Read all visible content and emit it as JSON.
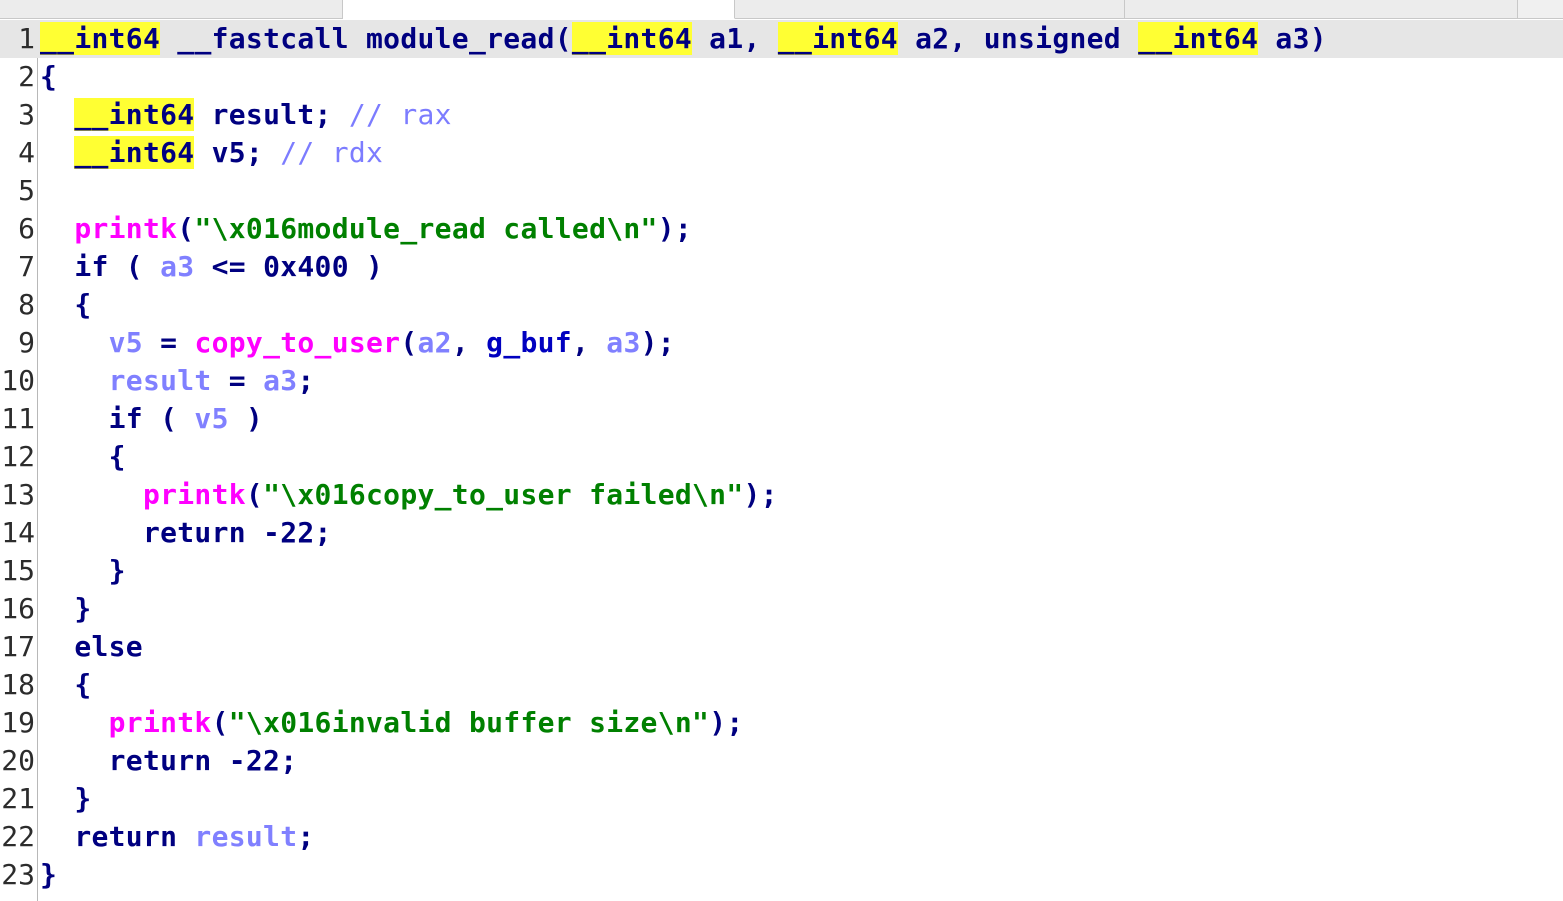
{
  "window": {
    "tabs": [
      {
        "label": ""
      },
      {
        "label": ""
      },
      {
        "label": ""
      },
      {
        "label": ""
      }
    ]
  },
  "editor": {
    "current_line": 1,
    "lines": [
      {
        "num": "1",
        "tokens": [
          {
            "t": "__int64",
            "c": "hl"
          },
          {
            "t": " ",
            "c": "kw"
          },
          {
            "t": "__fastcall module_read(",
            "c": "kw"
          },
          {
            "t": "__int64",
            "c": "hl"
          },
          {
            "t": " a1, ",
            "c": "kw"
          },
          {
            "t": "__int64",
            "c": "hl"
          },
          {
            "t": " a2, unsigned ",
            "c": "kw"
          },
          {
            "t": "__int64",
            "c": "hl"
          },
          {
            "t": " a3)",
            "c": "kw"
          }
        ]
      },
      {
        "num": "2",
        "tokens": [
          {
            "t": "{",
            "c": "kw"
          }
        ]
      },
      {
        "num": "3",
        "tokens": [
          {
            "t": "  ",
            "c": "kw"
          },
          {
            "t": "__int64",
            "c": "hl"
          },
          {
            "t": " result; ",
            "c": "kw"
          },
          {
            "t": "// rax",
            "c": "cmt"
          }
        ]
      },
      {
        "num": "4",
        "tokens": [
          {
            "t": "  ",
            "c": "kw"
          },
          {
            "t": "__int64",
            "c": "hl"
          },
          {
            "t": " v5; ",
            "c": "kw"
          },
          {
            "t": "// rdx",
            "c": "cmt"
          }
        ]
      },
      {
        "num": "5",
        "tokens": []
      },
      {
        "num": "6",
        "tokens": [
          {
            "t": "  ",
            "c": "kw"
          },
          {
            "t": "printk",
            "c": "fn"
          },
          {
            "t": "(",
            "c": "kw"
          },
          {
            "t": "\"\\x016module_read called\\n\"",
            "c": "str"
          },
          {
            "t": ");",
            "c": "kw"
          }
        ]
      },
      {
        "num": "7",
        "tokens": [
          {
            "t": "  if ( ",
            "c": "kw"
          },
          {
            "t": "a3",
            "c": "var"
          },
          {
            "t": " <= 0x400 )",
            "c": "kw"
          }
        ]
      },
      {
        "num": "8",
        "tokens": [
          {
            "t": "  {",
            "c": "kw"
          }
        ]
      },
      {
        "num": "9",
        "tokens": [
          {
            "t": "    ",
            "c": "kw"
          },
          {
            "t": "v5",
            "c": "var"
          },
          {
            "t": " = ",
            "c": "kw"
          },
          {
            "t": "copy_to_user",
            "c": "fn"
          },
          {
            "t": "(",
            "c": "kw"
          },
          {
            "t": "a2",
            "c": "var"
          },
          {
            "t": ", ",
            "c": "kw"
          },
          {
            "t": "g_buf",
            "c": "glob"
          },
          {
            "t": ", ",
            "c": "kw"
          },
          {
            "t": "a3",
            "c": "var"
          },
          {
            "t": ");",
            "c": "kw"
          }
        ]
      },
      {
        "num": "10",
        "tokens": [
          {
            "t": "    ",
            "c": "kw"
          },
          {
            "t": "result",
            "c": "var"
          },
          {
            "t": " = ",
            "c": "kw"
          },
          {
            "t": "a3",
            "c": "var"
          },
          {
            "t": ";",
            "c": "kw"
          }
        ]
      },
      {
        "num": "11",
        "tokens": [
          {
            "t": "    if ( ",
            "c": "kw"
          },
          {
            "t": "v5",
            "c": "var"
          },
          {
            "t": " )",
            "c": "kw"
          }
        ]
      },
      {
        "num": "12",
        "tokens": [
          {
            "t": "    {",
            "c": "kw"
          }
        ]
      },
      {
        "num": "13",
        "tokens": [
          {
            "t": "      ",
            "c": "kw"
          },
          {
            "t": "printk",
            "c": "fn"
          },
          {
            "t": "(",
            "c": "kw"
          },
          {
            "t": "\"\\x016copy_to_user failed\\n\"",
            "c": "str"
          },
          {
            "t": ");",
            "c": "kw"
          }
        ]
      },
      {
        "num": "14",
        "tokens": [
          {
            "t": "      return -22;",
            "c": "kw"
          }
        ]
      },
      {
        "num": "15",
        "tokens": [
          {
            "t": "    }",
            "c": "kw"
          }
        ]
      },
      {
        "num": "16",
        "tokens": [
          {
            "t": "  }",
            "c": "kw"
          }
        ]
      },
      {
        "num": "17",
        "tokens": [
          {
            "t": "  else",
            "c": "kw"
          }
        ]
      },
      {
        "num": "18",
        "tokens": [
          {
            "t": "  {",
            "c": "kw"
          }
        ]
      },
      {
        "num": "19",
        "tokens": [
          {
            "t": "    ",
            "c": "kw"
          },
          {
            "t": "printk",
            "c": "fn"
          },
          {
            "t": "(",
            "c": "kw"
          },
          {
            "t": "\"\\x016invalid buffer size\\n\"",
            "c": "str"
          },
          {
            "t": ");",
            "c": "kw"
          }
        ]
      },
      {
        "num": "20",
        "tokens": [
          {
            "t": "    return -22;",
            "c": "kw"
          }
        ]
      },
      {
        "num": "21",
        "tokens": [
          {
            "t": "  }",
            "c": "kw"
          }
        ]
      },
      {
        "num": "22",
        "tokens": [
          {
            "t": "  return ",
            "c": "kw"
          },
          {
            "t": "result",
            "c": "var"
          },
          {
            "t": ";",
            "c": "kw"
          }
        ]
      },
      {
        "num": "23",
        "tokens": [
          {
            "t": "}",
            "c": "kw"
          }
        ]
      }
    ]
  },
  "colors": {
    "keyword": "#000080",
    "highlight": "#ffff33",
    "variable": "#8080ff",
    "function": "#ff00ff",
    "string": "#008000",
    "comment": "#7c7cff",
    "global": "#0000c0",
    "current_line_bg": "#e6e6e6"
  }
}
